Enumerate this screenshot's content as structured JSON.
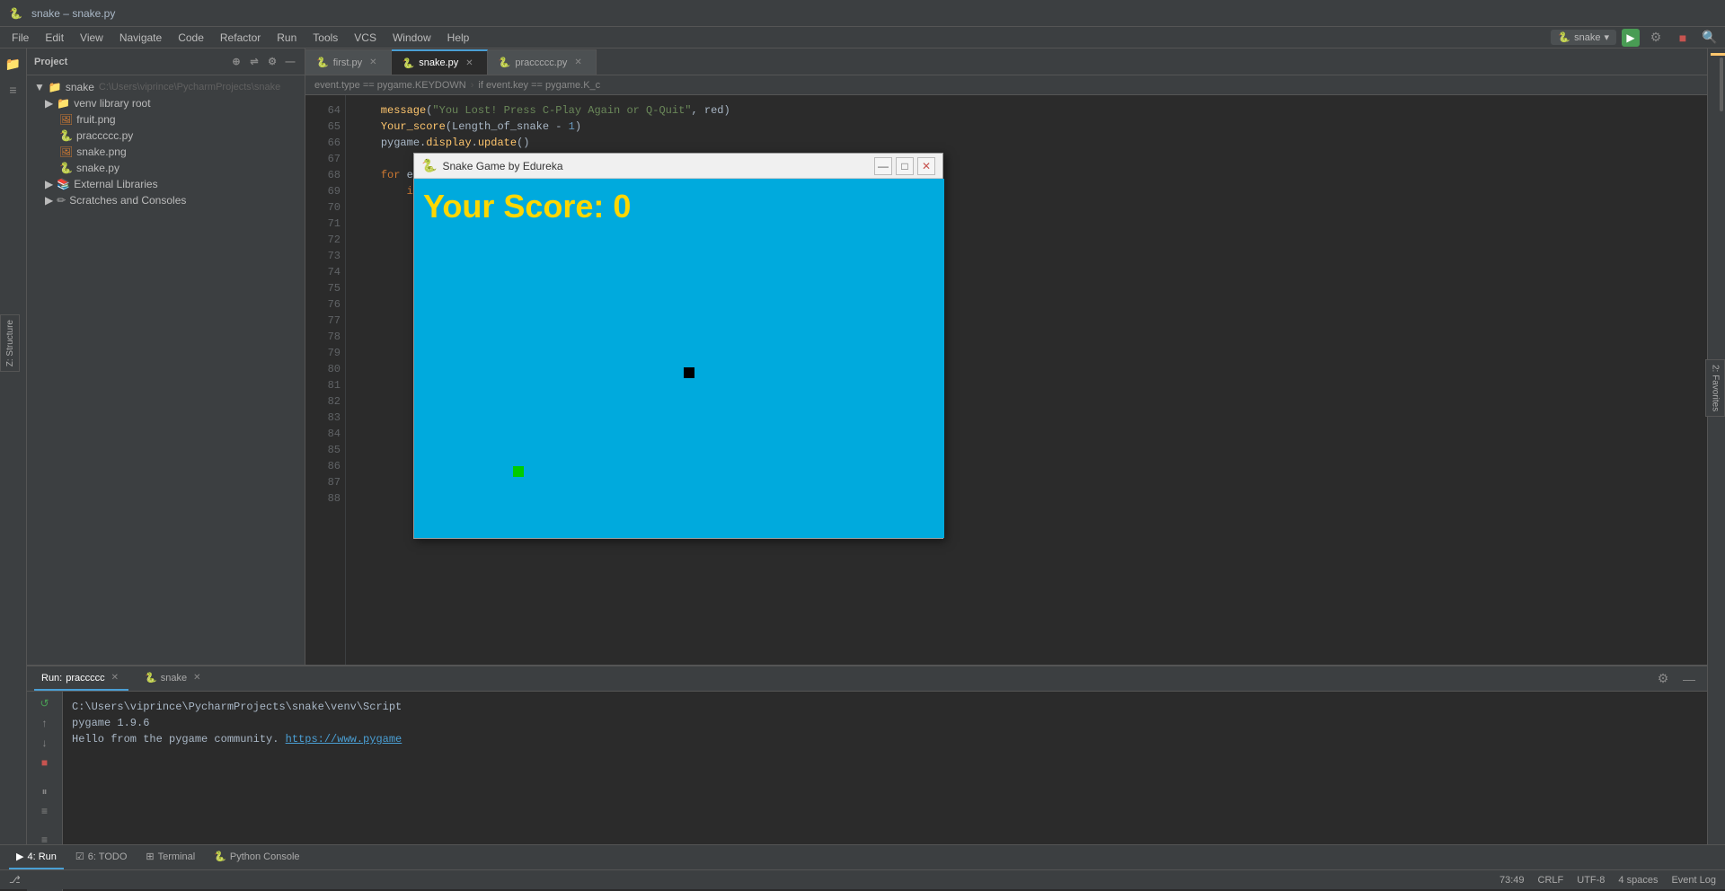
{
  "titlebar": {
    "icon": "🐍",
    "text": "snake – snake.py"
  },
  "menubar": {
    "items": [
      "File",
      "Edit",
      "View",
      "Navigate",
      "Code",
      "Refactor",
      "Run",
      "Tools",
      "VCS",
      "Window",
      "Help"
    ]
  },
  "toolbar": {
    "config_name": "snake",
    "run_label": "Run",
    "search_icon": "🔍"
  },
  "project_panel": {
    "title": "Project",
    "root": "snake",
    "root_path": "C:\\Users\\viprince\\PycharmProjects\\snake",
    "items": [
      {
        "label": "venv library root",
        "indent": 1,
        "type": "folder"
      },
      {
        "label": "fruit.png",
        "indent": 2,
        "type": "png"
      },
      {
        "label": "praccccc.py",
        "indent": 2,
        "type": "py"
      },
      {
        "label": "snake.png",
        "indent": 2,
        "type": "png"
      },
      {
        "label": "snake.py",
        "indent": 2,
        "type": "py"
      },
      {
        "label": "External Libraries",
        "indent": 1,
        "type": "folder"
      },
      {
        "label": "Scratches and Consoles",
        "indent": 1,
        "type": "folder"
      }
    ]
  },
  "tabs": [
    {
      "label": "first.py",
      "active": false
    },
    {
      "label": "snake.py",
      "active": true
    },
    {
      "label": "praccccc.py",
      "active": false
    }
  ],
  "breadcrumb": {
    "items": [
      "event.type == pygame.KEYDOWN",
      "if event.key == pygame.K_c"
    ]
  },
  "code": {
    "lines": [
      {
        "num": 64,
        "content": "    message(\"You Lost! Press C-Play Again or Q-Quit\", red)"
      },
      {
        "num": 65,
        "content": "    Your_score(Length_of_snake - 1)"
      },
      {
        "num": 66,
        "content": "    pygame.display.update()"
      },
      {
        "num": 67,
        "content": ""
      },
      {
        "num": 68,
        "content": "    for event in pygame.event.get():"
      },
      {
        "num": 69,
        "content": "        if event.type == pygame.KEYDOWN:"
      },
      {
        "num": 70,
        "content": ""
      },
      {
        "num": 71,
        "content": ""
      },
      {
        "num": 72,
        "content": ""
      },
      {
        "num": 73,
        "content": ""
      },
      {
        "num": 74,
        "content": ""
      },
      {
        "num": 75,
        "content": ""
      },
      {
        "num": 76,
        "content": ""
      },
      {
        "num": 77,
        "content": ""
      },
      {
        "num": 78,
        "content": ""
      },
      {
        "num": 79,
        "content": ""
      },
      {
        "num": 80,
        "content": ""
      },
      {
        "num": 81,
        "content": ""
      },
      {
        "num": 82,
        "content": ""
      },
      {
        "num": 83,
        "content": ""
      },
      {
        "num": 84,
        "content": ""
      },
      {
        "num": 85,
        "content": ""
      },
      {
        "num": 86,
        "content": ""
      },
      {
        "num": 87,
        "content": ""
      },
      {
        "num": 88,
        "content": ""
      }
    ]
  },
  "snake_window": {
    "title": "Snake Game by Edureka",
    "icon": "🐍",
    "score_label": "Your Score: 0"
  },
  "bottom_panel": {
    "tabs": [
      {
        "label": "praccccc",
        "prefix": "Run:",
        "active": true
      },
      {
        "label": "snake",
        "prefix": "",
        "active": false
      }
    ],
    "footer_tabs": [
      {
        "label": "4: Run",
        "icon": "▶"
      },
      {
        "label": "6: TODO",
        "icon": "☑"
      },
      {
        "label": "Terminal",
        "icon": ">"
      },
      {
        "label": "Python Console",
        "icon": "🐍"
      }
    ],
    "terminal": {
      "line1": "C:\\Users\\viprince\\PycharmProjects\\snake\\venv\\Script",
      "line2": "pygame 1.9.6",
      "line3": "Hello from the pygame community.",
      "link": "https://www.pygame"
    }
  },
  "statusbar": {
    "position": "73:49",
    "encoding": "UTF-8",
    "line_sep": "CRLF",
    "indent": "4 spaces",
    "event_log": "Event Log"
  }
}
